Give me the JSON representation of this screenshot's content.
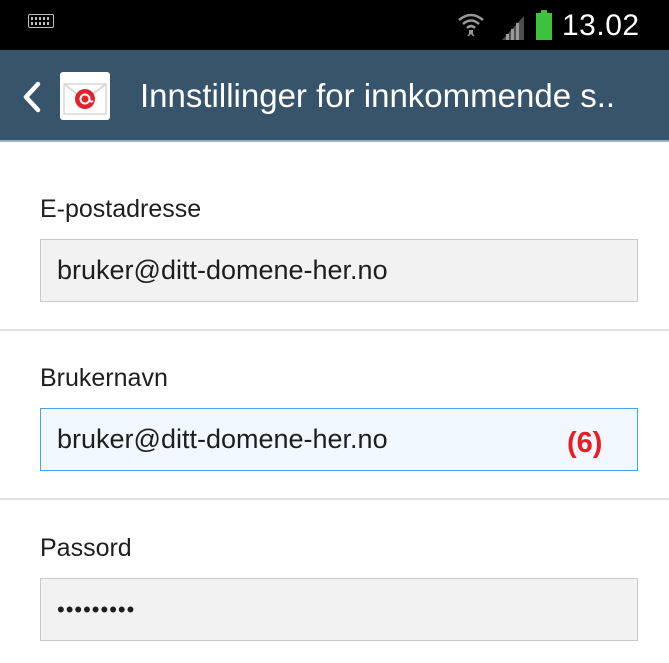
{
  "status_bar": {
    "time": "13.02",
    "icons": [
      "keyboard-icon",
      "wifi-icon",
      "signal-icon",
      "battery-icon"
    ]
  },
  "action_bar": {
    "title": "Innstillinger for innkommende s..",
    "icons": [
      "back-icon",
      "email-app-icon"
    ]
  },
  "form": {
    "email": {
      "label": "E-postadresse",
      "value": "bruker@ditt-domene-her.no"
    },
    "username": {
      "label": "Brukernavn",
      "value": "bruker@ditt-domene-her.no",
      "annotation": "(6)"
    },
    "password": {
      "label": "Passord",
      "value": "•••••••••"
    }
  },
  "colors": {
    "action_bar_bg": "#38546a",
    "status_bar_bg": "#000000",
    "focus_border": "#4aa0ea",
    "annotation": "#ec1c24",
    "battery": "#3ec23e"
  }
}
